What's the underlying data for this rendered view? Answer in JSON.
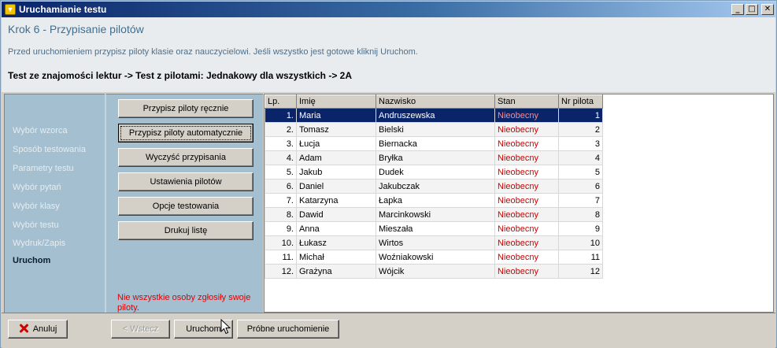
{
  "window": {
    "title": "Uruchamianie testu",
    "controls": {
      "minimize": "_",
      "maximize": "□",
      "close": "✕"
    }
  },
  "header": {
    "step_title": "Krok 6 - Przypisanie pilotów",
    "instruction": "Przed uruchomieniem przypisz piloty klasie oraz nauczycielowi. Jeśli wszystko jest gotowe kliknij Uruchom.",
    "path": "Test ze znajomości lektur -> Test z pilotami: Jednakowy dla wszystkich -> 2A"
  },
  "sidebar": {
    "items": [
      {
        "label": "Wybór wzorca",
        "active": false
      },
      {
        "label": "Sposób testowania",
        "active": false
      },
      {
        "label": "Parametry testu",
        "active": false
      },
      {
        "label": "Wybór pytań",
        "active": false
      },
      {
        "label": "Wybór klasy",
        "active": false
      },
      {
        "label": "Wybór testu",
        "active": false
      },
      {
        "label": "Wydruk/Zapis",
        "active": false
      },
      {
        "label": "Uruchom",
        "active": true
      }
    ]
  },
  "actions": {
    "buttons": [
      {
        "label": "Przypisz piloty ręcznie"
      },
      {
        "label": "Przypisz piloty automatycznie"
      },
      {
        "label": "Wyczyść przypisania"
      },
      {
        "label": "Ustawienia pilotów"
      },
      {
        "label": "Opcje testowania"
      },
      {
        "label": "Drukuj listę"
      }
    ],
    "warning": "Nie wszystkie osoby zgłosiły swoje piloty."
  },
  "grid": {
    "columns": [
      "Lp.",
      "Imię",
      "Nazwisko",
      "Stan",
      "Nr pilota"
    ],
    "rows": [
      {
        "lp": "1.",
        "imie": "Maria",
        "nazwisko": "Andruszewska",
        "stan": "Nieobecny",
        "nr": "1"
      },
      {
        "lp": "2.",
        "imie": "Tomasz",
        "nazwisko": "Bielski",
        "stan": "Nieobecny",
        "nr": "2"
      },
      {
        "lp": "3.",
        "imie": "Łucja",
        "nazwisko": "Biernacka",
        "stan": "Nieobecny",
        "nr": "3"
      },
      {
        "lp": "4.",
        "imie": "Adam",
        "nazwisko": "Bryłka",
        "stan": "Nieobecny",
        "nr": "4"
      },
      {
        "lp": "5.",
        "imie": "Jakub",
        "nazwisko": "Dudek",
        "stan": "Nieobecny",
        "nr": "5"
      },
      {
        "lp": "6.",
        "imie": "Daniel",
        "nazwisko": "Jakubczak",
        "stan": "Nieobecny",
        "nr": "6"
      },
      {
        "lp": "7.",
        "imie": "Katarzyna",
        "nazwisko": "Łapka",
        "stan": "Nieobecny",
        "nr": "7"
      },
      {
        "lp": "8.",
        "imie": "Dawid",
        "nazwisko": "Marcinkowski",
        "stan": "Nieobecny",
        "nr": "8"
      },
      {
        "lp": "9.",
        "imie": "Anna",
        "nazwisko": "Mieszała",
        "stan": "Nieobecny",
        "nr": "9"
      },
      {
        "lp": "10.",
        "imie": "Łukasz",
        "nazwisko": "Wirtos",
        "stan": "Nieobecny",
        "nr": "10"
      },
      {
        "lp": "11.",
        "imie": "Michał",
        "nazwisko": "Woźniakowski",
        "stan": "Nieobecny",
        "nr": "11"
      },
      {
        "lp": "12.",
        "imie": "Grażyna",
        "nazwisko": "Wójcik",
        "stan": "Nieobecny",
        "nr": "12"
      }
    ],
    "selected_row": 0
  },
  "footer": {
    "cancel": "Anuluj",
    "back": "< Wstecz",
    "run": "Uruchom",
    "trial_run": "Próbne uruchomienie"
  },
  "colors": {
    "title_bar": "#0a246a",
    "panel": "#a3bfd0",
    "status_absent": "#d00000",
    "selection": "#0a246a"
  }
}
